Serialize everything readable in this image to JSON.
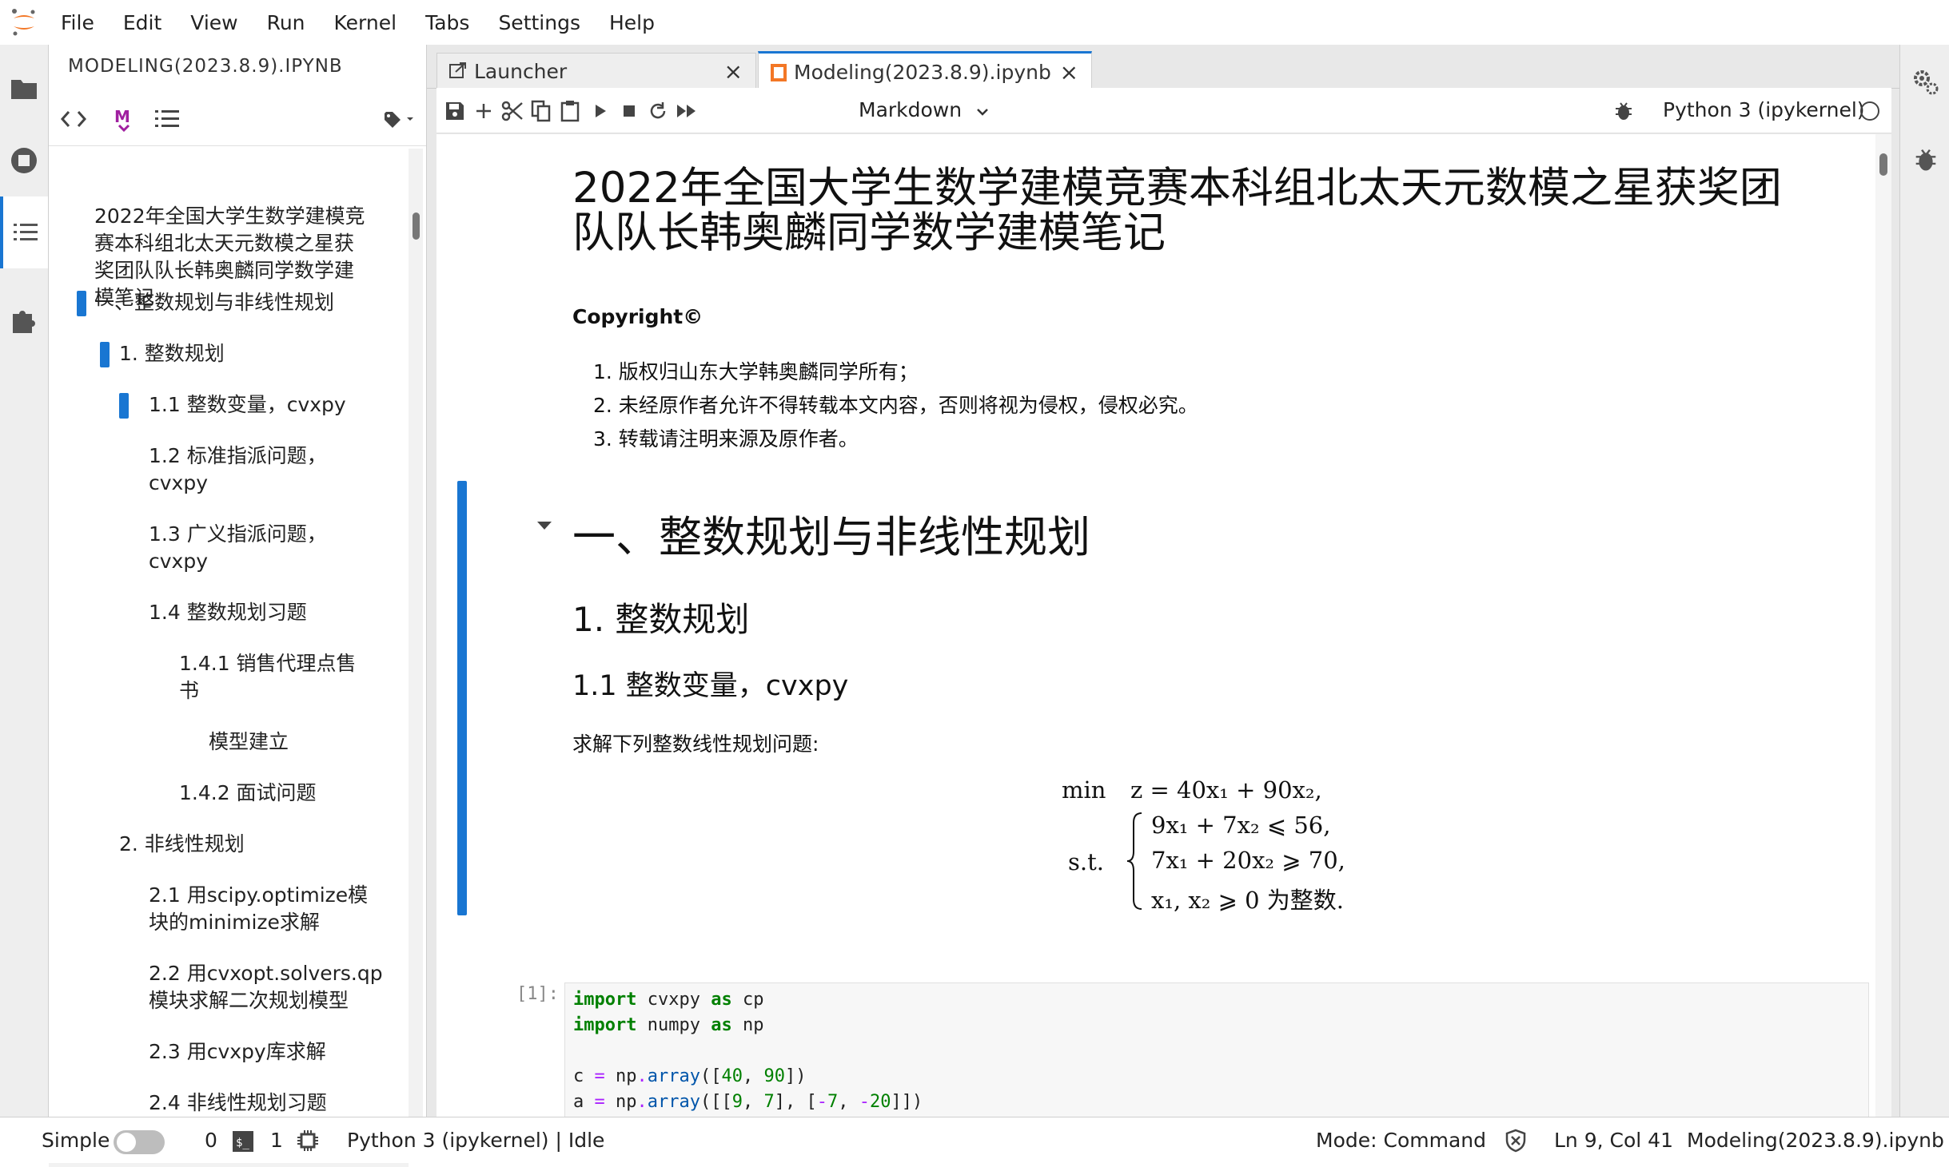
{
  "menu": {
    "items": [
      "File",
      "Edit",
      "View",
      "Run",
      "Kernel",
      "Tabs",
      "Settings",
      "Help"
    ]
  },
  "toc": {
    "title": "MODELING(2023.8.9).IPYNB",
    "tools": {
      "code_icon": "code-icon",
      "markdown_icon": "markdown-icon",
      "list_icon": "numbered-list-icon",
      "tag_icon": "tag-icon"
    },
    "entries": [
      {
        "text": "2022年全国大学生数学建模竞"
      },
      {
        "text": "赛本科组北太天元数模之星获"
      },
      {
        "text": "奖团队队长韩奥麟同学数学建"
      },
      {
        "text": "模笔记"
      },
      {
        "text": "一、整数规划与非线性规划"
      },
      {
        "text": "1. 整数规划"
      },
      {
        "text": "1.1 整数变量，cvxpy"
      },
      {
        "text": "1.2 标准指派问题，"
      },
      {
        "text": "cvxpy"
      },
      {
        "text": "1.3 广义指派问题，"
      },
      {
        "text": "cvxpy"
      },
      {
        "text": "1.4 整数规划习题"
      },
      {
        "text": "1.4.1 销售代理点售"
      },
      {
        "text": "书"
      },
      {
        "text": "模型建立"
      },
      {
        "text": "1.4.2 面试问题"
      },
      {
        "text": "2. 非线性规划"
      },
      {
        "text": "2.1 用scipy.optimize模"
      },
      {
        "text": "块的minimize求解"
      },
      {
        "text": "2.2 用cvxopt.solvers.qp"
      },
      {
        "text": "模块求解二次规划模型"
      },
      {
        "text": "2.3 用cvxpy库求解"
      },
      {
        "text": "2.4 非线性规划习题"
      }
    ]
  },
  "tabs": [
    {
      "label": "Launcher",
      "icon": "launcher-icon"
    },
    {
      "label": "Modeling(2023.8.9).ipynb",
      "icon": "notebook-icon"
    }
  ],
  "toolbar": {
    "cell_type": "Markdown",
    "kernel": "Python 3 (ipykernel)"
  },
  "notebook": {
    "title_line1": "2022年全国大学生数学建模竞赛本科组北太天元数模之星获奖团",
    "title_line2": "队队长韩奥麟同学数学建模笔记",
    "copyright": "Copyright©",
    "list": [
      "1. 版权归山东大学韩奥麟同学所有；",
      "2. 未经原作者允许不得转载本文内容，否则将视为侵权，侵权必究。",
      "3. 转载请注明来源及原作者。"
    ],
    "h1": "一、整数规划与非线性规划",
    "h2": "1. 整数规划",
    "h3": "1.1 整数变量，cvxpy",
    "para": "求解下列整数线性规划问题:",
    "math": {
      "min_label": "min",
      "objective": "z = 40x₁ + 90x₂,",
      "st_label": "s.t.",
      "c1": "9x₁ + 7x₂ ⩽ 56,",
      "c2": "7x₁ + 20x₂ ⩾ 70,",
      "c3": "x₁, x₂ ⩾ 0 为整数."
    },
    "code_prompt": "[1]:"
  },
  "status": {
    "mode_toggle": "Simple",
    "terminals": "0",
    "kernels": "1",
    "kernel_status": "Python 3 (ipykernel) | Idle",
    "mode": "Mode: Command",
    "cursor": "Ln 9, Col 41",
    "file": "Modeling(2023.8.9).ipynb"
  }
}
